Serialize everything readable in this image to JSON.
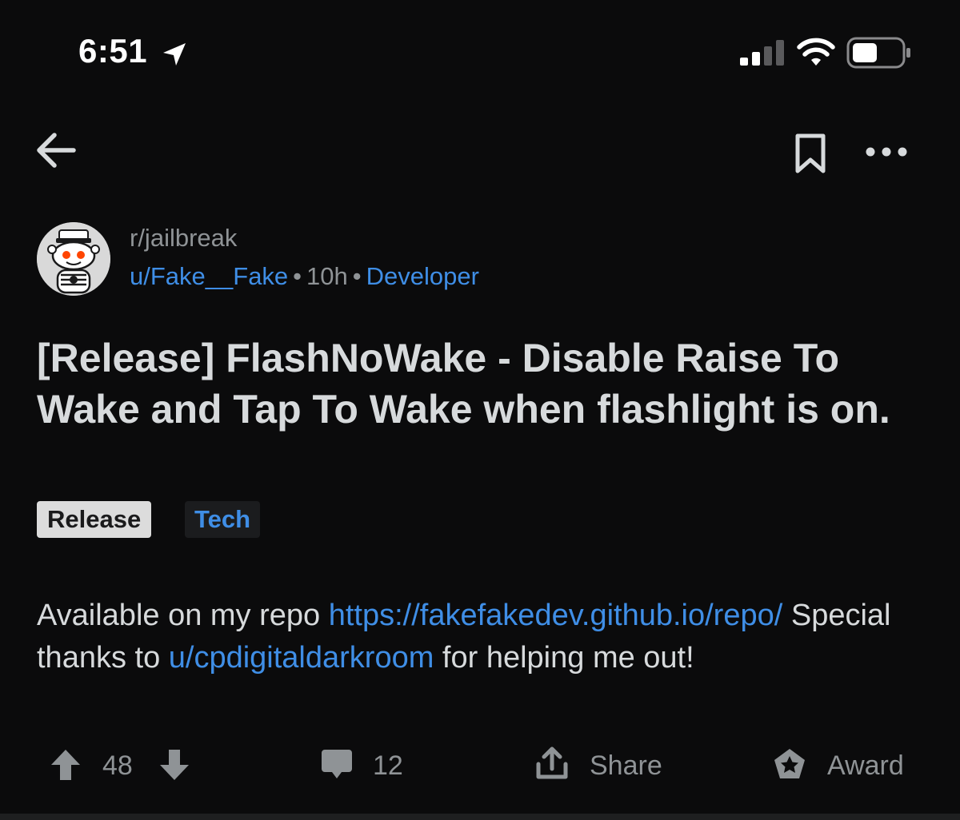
{
  "status_bar": {
    "time": "6:51"
  },
  "header": {
    "subreddit": "r/jailbreak",
    "author": "u/Fake__Fake",
    "separator": "•",
    "age": "10h",
    "user_flair": "Developer"
  },
  "post": {
    "title": "[Release] FlashNoWake - Disable Raise To Wake and Tap To Wake when flashlight is on.",
    "flairs": [
      "Release",
      "Tech"
    ],
    "body": {
      "text_1": "Available on my repo ",
      "link_1": "https://fakefakedev.github.io/repo/",
      "text_2": " Special thanks to ",
      "link_2": "u/cpdigitaldarkroom",
      "text_3": " for helping me out!"
    }
  },
  "actions": {
    "upvotes": "48",
    "comments": "12",
    "share_label": "Share",
    "award_label": "Award"
  },
  "colors": {
    "background": "#0b0b0c",
    "text": "#d7dadc",
    "muted": "#8f9396",
    "link": "#3f8ee6"
  },
  "icons": [
    "location-arrow-icon",
    "cellular-signal-icon",
    "wifi-icon",
    "battery-icon",
    "back-arrow-icon",
    "bookmark-icon",
    "more-options-icon",
    "upvote-icon",
    "downvote-icon",
    "comment-icon",
    "share-icon",
    "award-icon"
  ]
}
